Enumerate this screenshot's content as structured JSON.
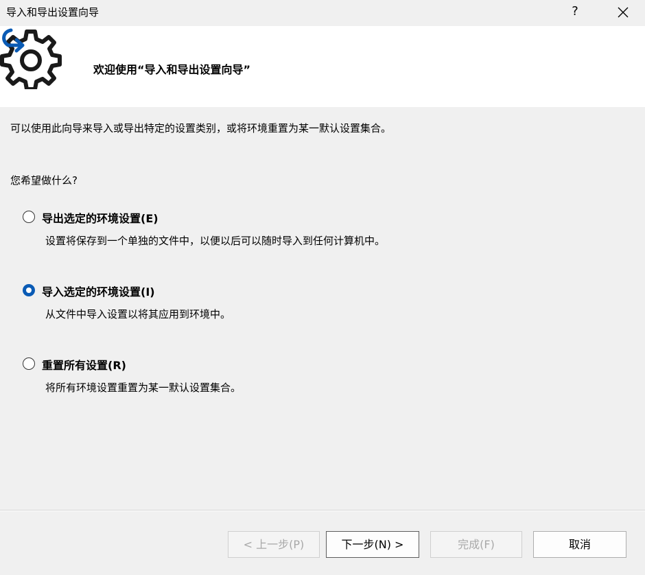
{
  "window": {
    "title": "导入和导出设置向导",
    "help_label": "?"
  },
  "header": {
    "title": "欢迎使用“导入和导出设置向导”",
    "logo_icon": "gear-with-arrow-icon",
    "accent_color": "#0a5bb5"
  },
  "intro_text": "可以使用此向导来导入或导出特定的设置类别，或将环境重置为某一默认设置集合。",
  "question": "您希望做什么?",
  "options": [
    {
      "label": "导出选定的环境设置(E)",
      "description": "设置将保存到一个单独的文件中，以便以后可以随时导入到任何计算机中。",
      "checked": false
    },
    {
      "label": "导入选定的环境设置(I)",
      "description": "从文件中导入设置以将其应用到环境中。",
      "checked": true
    },
    {
      "label": "重置所有设置(R)",
      "description": "将所有环境设置重置为某一默认设置集合。",
      "checked": false
    }
  ],
  "buttons": {
    "back": "< 上一步(P)",
    "next": "下一步(N) >",
    "finish": "完成(F)",
    "cancel": "取消"
  }
}
